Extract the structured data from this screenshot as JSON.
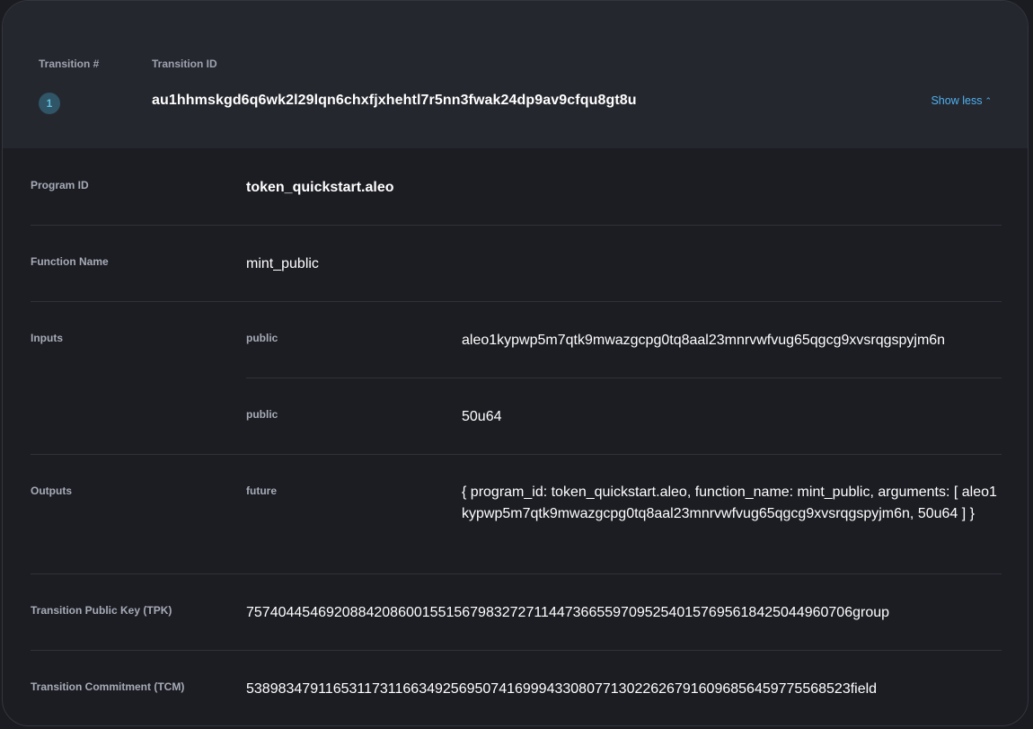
{
  "header": {
    "col_transition_num": "Transition #",
    "col_transition_id": "Transition ID",
    "transition_number": "1",
    "transition_id": "au1hhmskgd6q6wk2l29lqn6chxfjxhehtl7r5nn3fwak24dp9av9cfqu8gt8u",
    "toggle_label": "Show less",
    "toggle_icon": "chevron-up-icon"
  },
  "details": {
    "program_id_label": "Program ID",
    "program_id": "token_quickstart.aleo",
    "function_name_label": "Function Name",
    "function_name": "mint_public",
    "inputs_label": "Inputs",
    "inputs": [
      {
        "type": "public",
        "value": "aleo1kypwp5m7qtk9mwazgcpg0tq8aal23mnrvwfvug65qgcg9xvsrqgspyjm6n"
      },
      {
        "type": "public",
        "value": "50u64"
      }
    ],
    "outputs_label": "Outputs",
    "outputs": [
      {
        "type": "future",
        "value": "{ program_id: token_quickstart.aleo, function_name: mint_public, arguments: [ aleo1kypwp5m7qtk9mwazgcpg0tq8aal23mnrvwfvug65qgcg9xvsrqgspyjm6n, 50u64 ] }"
      }
    ],
    "tpk_label": "Transition Public Key (TPK)",
    "tpk": "7574044546920884208600155156798327271144736655970952540157695618425044960706group",
    "tcm_label": "Transition Commitment (TCM)",
    "tcm": "5389834791165311731166349256950741699943308077130226267916096856459775568523field"
  }
}
